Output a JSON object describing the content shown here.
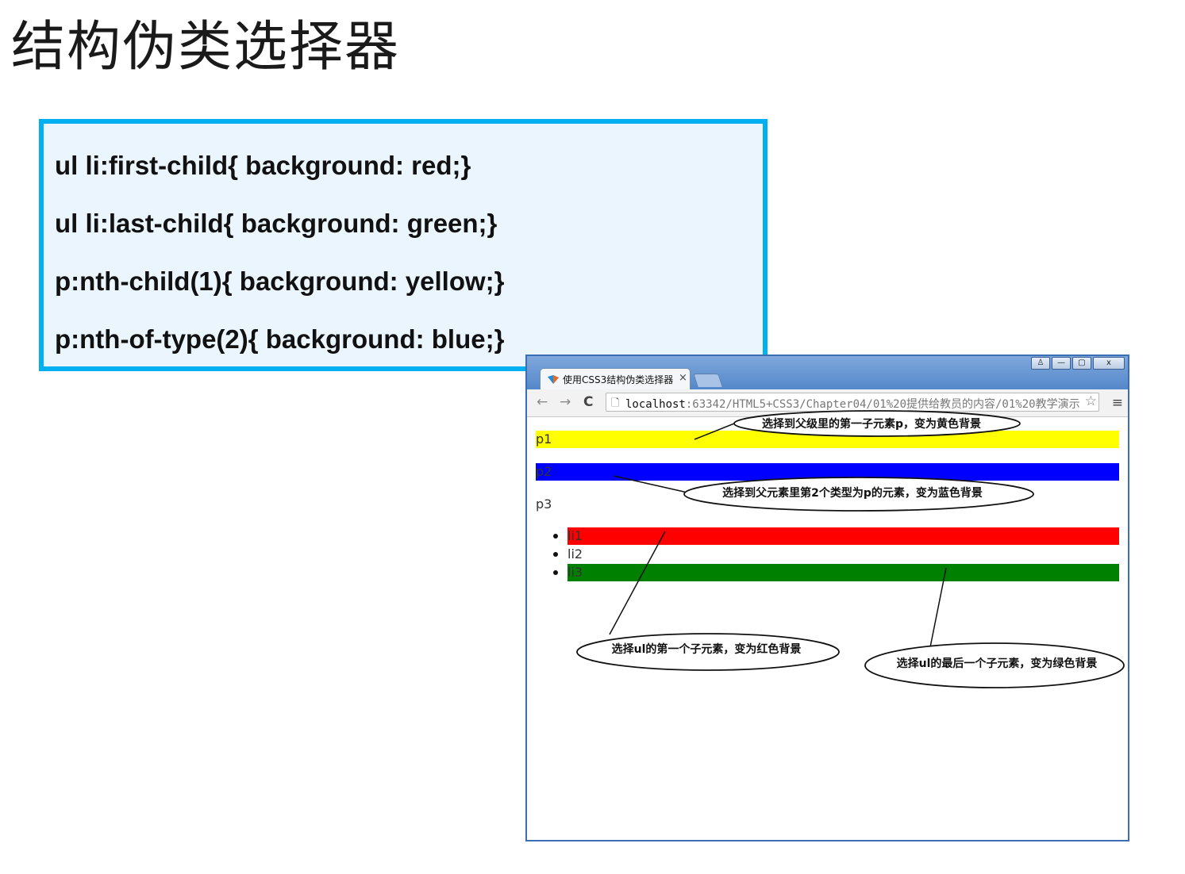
{
  "slide": {
    "title": "结构伪类选择器",
    "code_lines": [
      "ul li:first-child{ background: red;}",
      "ul li:last-child{ background: green;}",
      "p:nth-child(1){ background: yellow;}",
      "p:nth-of-type(2){ background: blue;}"
    ]
  },
  "browser": {
    "tab_title": "使用CSS3结构伪类选择器",
    "tab_close": "×",
    "window_buttons": [
      "♙",
      "—",
      "▢",
      "x"
    ],
    "nav": {
      "back": "←",
      "forward": "→",
      "reload": "C"
    },
    "url_host": "localhost",
    "url_path": ":63342/HTML5+CSS3/Chapter04/01%20提供给教员的内容/01%20教学演示",
    "star": "☆",
    "menu": "≡",
    "page": {
      "paragraphs": [
        "p1",
        "p2",
        "p3"
      ],
      "list_items": [
        "li1",
        "li2",
        "li3"
      ],
      "colors": {
        "p1": "#ffff00",
        "p2": "#0000ff",
        "li1": "#ff0000",
        "li3": "#008000"
      }
    }
  },
  "annotations": [
    "选择到父级里的第一子元素p，变为黄色背景",
    "选择到父元素里第2个类型为p的元素，变为蓝色背景",
    "选择ul的第一个子元素，变为红色背景",
    "选择ul的最后一个子元素，变为绿色背景"
  ]
}
